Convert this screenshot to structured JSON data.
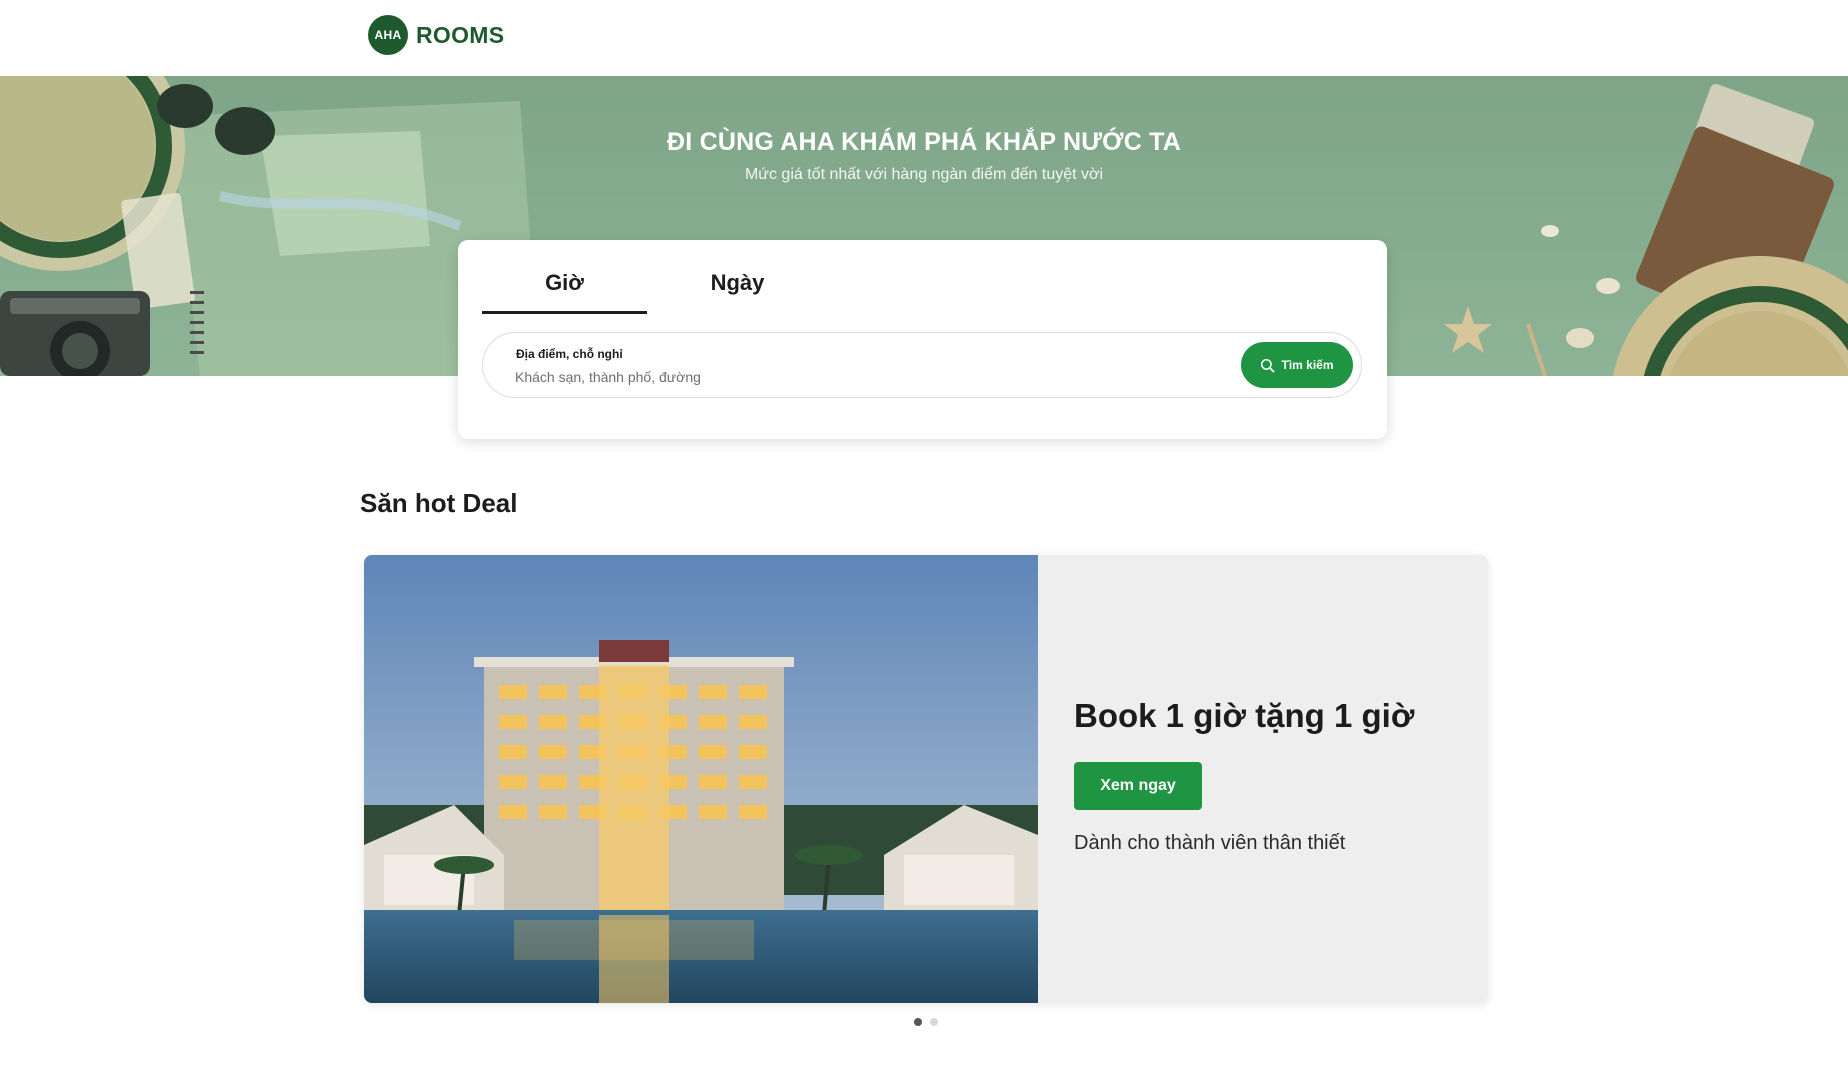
{
  "header": {
    "logo_badge": "AHA",
    "logo_text": "ROOMS"
  },
  "hero": {
    "title": "ĐI CÙNG AHA KHÁM PHÁ KHẮP NƯỚC TA",
    "subtitle": "Mức giá tốt nhất với hàng ngàn điểm đến tuyệt vời"
  },
  "search": {
    "tabs": [
      {
        "label": "Giờ",
        "active": true
      },
      {
        "label": "Ngày",
        "active": false
      }
    ],
    "field_label": "Địa điểm, chỗ nghỉ",
    "placeholder": "Khách sạn, thành phố, đường",
    "button_label": "Tìm kiếm",
    "button_icon": "search-icon"
  },
  "deals": {
    "section_title": "Săn hot Deal",
    "items": [
      {
        "title": "Book 1 giờ tặng 1 giờ",
        "button_label": "Xem ngay",
        "description": "Dành cho thành viên thân thiết"
      }
    ],
    "carousel_count": 2,
    "carousel_active_index": 0
  },
  "colors": {
    "brand_dark_green": "#1f5a2e",
    "accent_green": "#1f9543",
    "hero_green": "#86ac8f",
    "deal_panel": "#eeeeee"
  }
}
